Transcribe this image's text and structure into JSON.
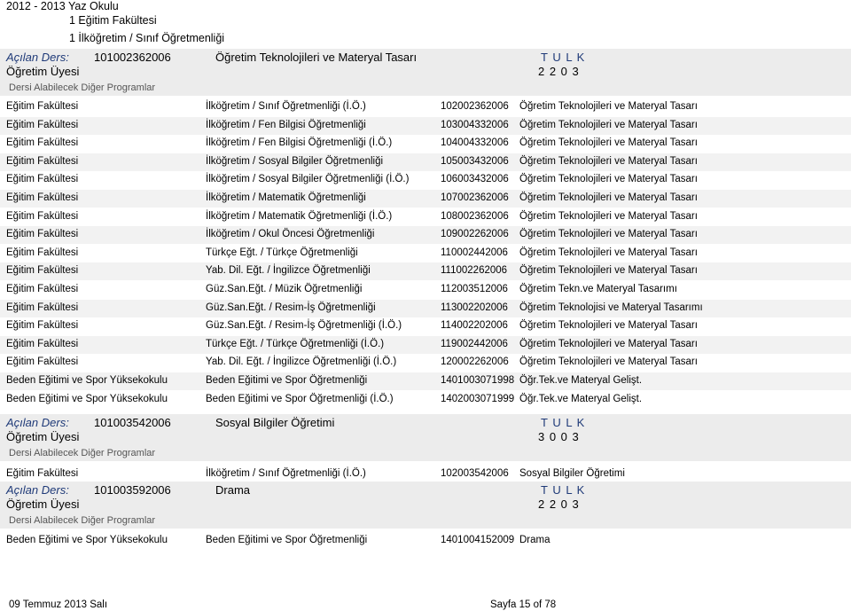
{
  "header": {
    "term": "2012 - 2013 Yaz Okulu",
    "faculty": "1 Eğitim Fakültesi",
    "program": "1 İlköğretim / Sınıf Öğretmenliği"
  },
  "labels": {
    "course": "Açılan Ders:",
    "teacher": "Öğretim Üyesi",
    "other_programs": "Dersi Alabilecek Diğer Programlar",
    "tulk": "T U L K"
  },
  "courses": [
    {
      "code": "101002362006",
      "name": "Öğretim Teknolojileri ve Materyal Tasarı",
      "credits": "2 2 0 3",
      "rows": [
        [
          "Eğitim Fakültesi",
          "İlköğretim / Sınıf Öğretmenliği (İ.Ö.)",
          "102002362006",
          "Öğretim Teknolojileri ve Materyal Tasarı"
        ],
        [
          "Eğitim Fakültesi",
          "İlköğretim / Fen Bilgisi Öğretmenliği",
          "103004332006",
          "Öğretim Teknolojileri ve Materyal Tasarı"
        ],
        [
          "Eğitim Fakültesi",
          "İlköğretim / Fen Bilgisi Öğretmenliği (İ.Ö.)",
          "104004332006",
          "Öğretim Teknolojileri ve Materyal Tasarı"
        ],
        [
          "Eğitim Fakültesi",
          "İlköğretim / Sosyal Bilgiler Öğretmenliği",
          "105003432006",
          "Öğretim Teknolojileri ve Materyal Tasarı"
        ],
        [
          "Eğitim Fakültesi",
          "İlköğretim / Sosyal Bilgiler Öğretmenliği (İ.Ö.)",
          "106003432006",
          "Öğretim Teknolojileri ve Materyal Tasarı"
        ],
        [
          "Eğitim Fakültesi",
          "İlköğretim / Matematik Öğretmenliği",
          "107002362006",
          "Öğretim Teknolojileri ve Materyal Tasarı"
        ],
        [
          "Eğitim Fakültesi",
          "İlköğretim / Matematik Öğretmenliği (İ.Ö.)",
          "108002362006",
          "Öğretim Teknolojileri ve Materyal Tasarı"
        ],
        [
          "Eğitim Fakültesi",
          "İlköğretim / Okul Öncesi Öğretmenliği",
          "109002262006",
          "Öğretim Teknolojileri ve Materyal Tasarı"
        ],
        [
          "Eğitim Fakültesi",
          "Türkçe Eğt. / Türkçe Öğretmenliği",
          "110002442006",
          "Öğretim Teknolojileri ve Materyal Tasarı"
        ],
        [
          "Eğitim Fakültesi",
          "Yab. Dil. Eğt. / İngilizce Öğretmenliği",
          "111002262006",
          "Öğretim Teknolojileri ve Materyal Tasarı"
        ],
        [
          "Eğitim Fakültesi",
          "Güz.San.Eğt. / Müzik Öğretmenliği",
          "112003512006",
          "Öğretim Tekn.ve Materyal Tasarımı"
        ],
        [
          "Eğitim Fakültesi",
          "Güz.San.Eğt. / Resim-İş Öğretmenliği",
          "113002202006",
          "Öğretim Teknolojisi ve Materyal Tasarımı"
        ],
        [
          "Eğitim Fakültesi",
          "Güz.San.Eğt. / Resim-İş Öğretmenliği (İ.Ö.)",
          "114002202006",
          "Öğretim Teknolojileri ve Materyal Tasarı"
        ],
        [
          "Eğitim Fakültesi",
          "Türkçe Eğt. / Türkçe Öğretmenliği (İ.Ö.)",
          "119002442006",
          "Öğretim Teknolojileri ve Materyal Tasarı"
        ],
        [
          "Eğitim Fakültesi",
          "Yab. Dil. Eğt. / İngilizce Öğretmenliği (İ.Ö.)",
          "120002262006",
          "Öğretim Teknolojileri ve Materyal Tasarı"
        ],
        [
          "Beden Eğitimi ve Spor Yüksekokulu",
          "Beden Eğitimi ve Spor Öğretmenliği",
          "1401003071998",
          "Öğr.Tek.ve Materyal Gelişt."
        ],
        [
          "Beden Eğitimi ve Spor Yüksekokulu",
          "Beden Eğitimi ve Spor Öğretmenliği (İ.Ö.)",
          "1402003071999",
          "Öğr.Tek.ve Materyal Gelişt."
        ]
      ]
    },
    {
      "code": "101003542006",
      "name": "Sosyal Bilgiler Öğretimi",
      "credits": "3 0 0 3",
      "rows": [
        [
          "Eğitim Fakültesi",
          "İlköğretim / Sınıf Öğretmenliği (İ.Ö.)",
          "102003542006",
          "Sosyal Bilgiler Öğretimi"
        ]
      ]
    },
    {
      "code": "101003592006",
      "name": "Drama",
      "credits": "2 2 0 3",
      "rows": [
        [
          "Beden Eğitimi ve Spor Yüksekokulu",
          "Beden Eğitimi ve Spor Öğretmenliği",
          "1401004152009",
          "Drama"
        ]
      ]
    }
  ],
  "footer": {
    "date": "09 Temmuz 2013 Salı",
    "page": "Sayfa 15 of 78"
  },
  "colors": {
    "label_blue": "#1f3a78",
    "band_gray": "#ececec",
    "alt_row": "#f2f2f2"
  }
}
